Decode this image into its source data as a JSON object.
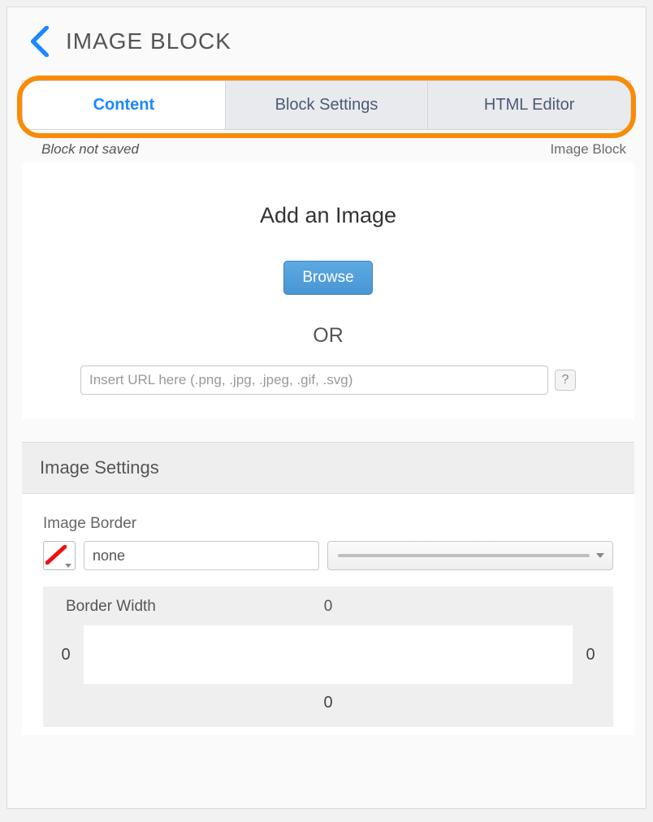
{
  "header": {
    "title": "IMAGE BLOCK"
  },
  "tabs": {
    "content": "Content",
    "block_settings": "Block Settings",
    "html_editor": "HTML Editor"
  },
  "status": {
    "not_saved": "Block not saved",
    "type_label": "Image Block"
  },
  "add_image": {
    "heading": "Add an Image",
    "browse_label": "Browse",
    "or_label": "OR",
    "url_placeholder": "Insert URL here (.png, .jpg, .jpeg, .gif, .svg)",
    "url_value": "",
    "help_label": "?"
  },
  "image_settings": {
    "heading": "Image Settings",
    "image_border_label": "Image Border",
    "border_style_value": "none",
    "border_width_label": "Border Width",
    "border_width": {
      "top": "0",
      "right": "0",
      "bottom": "0",
      "left": "0"
    }
  },
  "colors": {
    "highlight": "#f88b08",
    "accent": "#1a88ff"
  }
}
